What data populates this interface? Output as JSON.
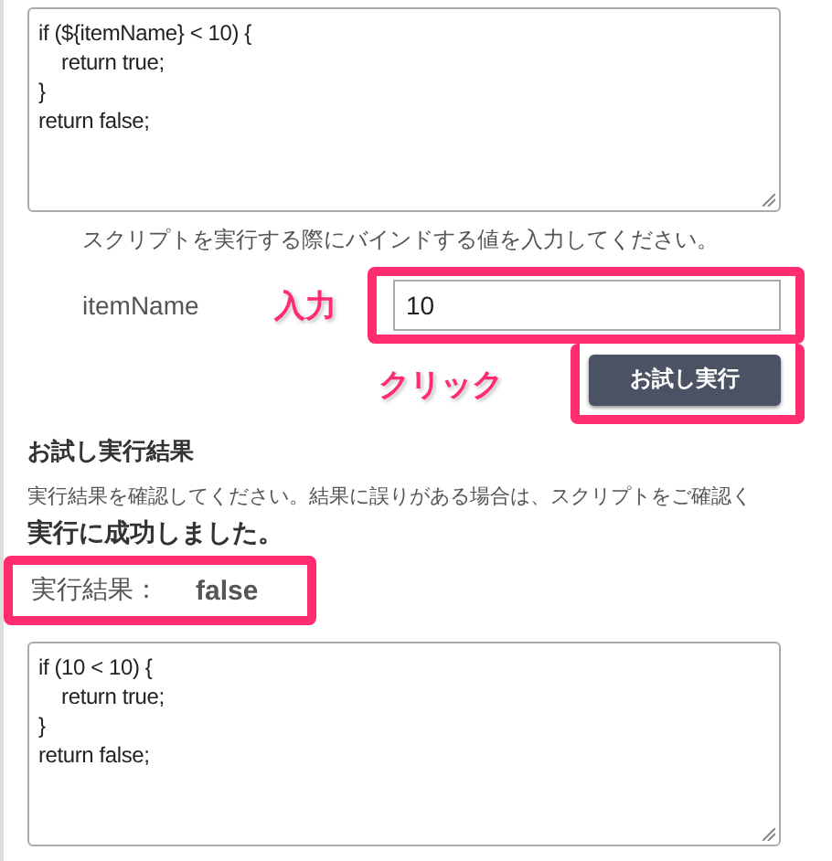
{
  "script_editor": {
    "code": "if (${itemName} < 10) {\n\treturn true;\n}\nreturn false;"
  },
  "bind_hint": "スクリプトを実行する際にバインドする値を入力してください。",
  "bindings": [
    {
      "name": "itemName",
      "value": "10"
    }
  ],
  "annotations": {
    "input_label": "入力",
    "click_label": "クリック"
  },
  "run_button": "お試し実行",
  "result_section": {
    "title": "お試し実行結果",
    "description": "実行結果を確認してください。結果に誤りがある場合は、スクリプトをご確認く",
    "status": "実行に成功しました。",
    "result_label": "実行結果：",
    "result_value": "false",
    "evaluated_code": "if (10 < 10) {\n\treturn true;\n}\nreturn false;"
  }
}
